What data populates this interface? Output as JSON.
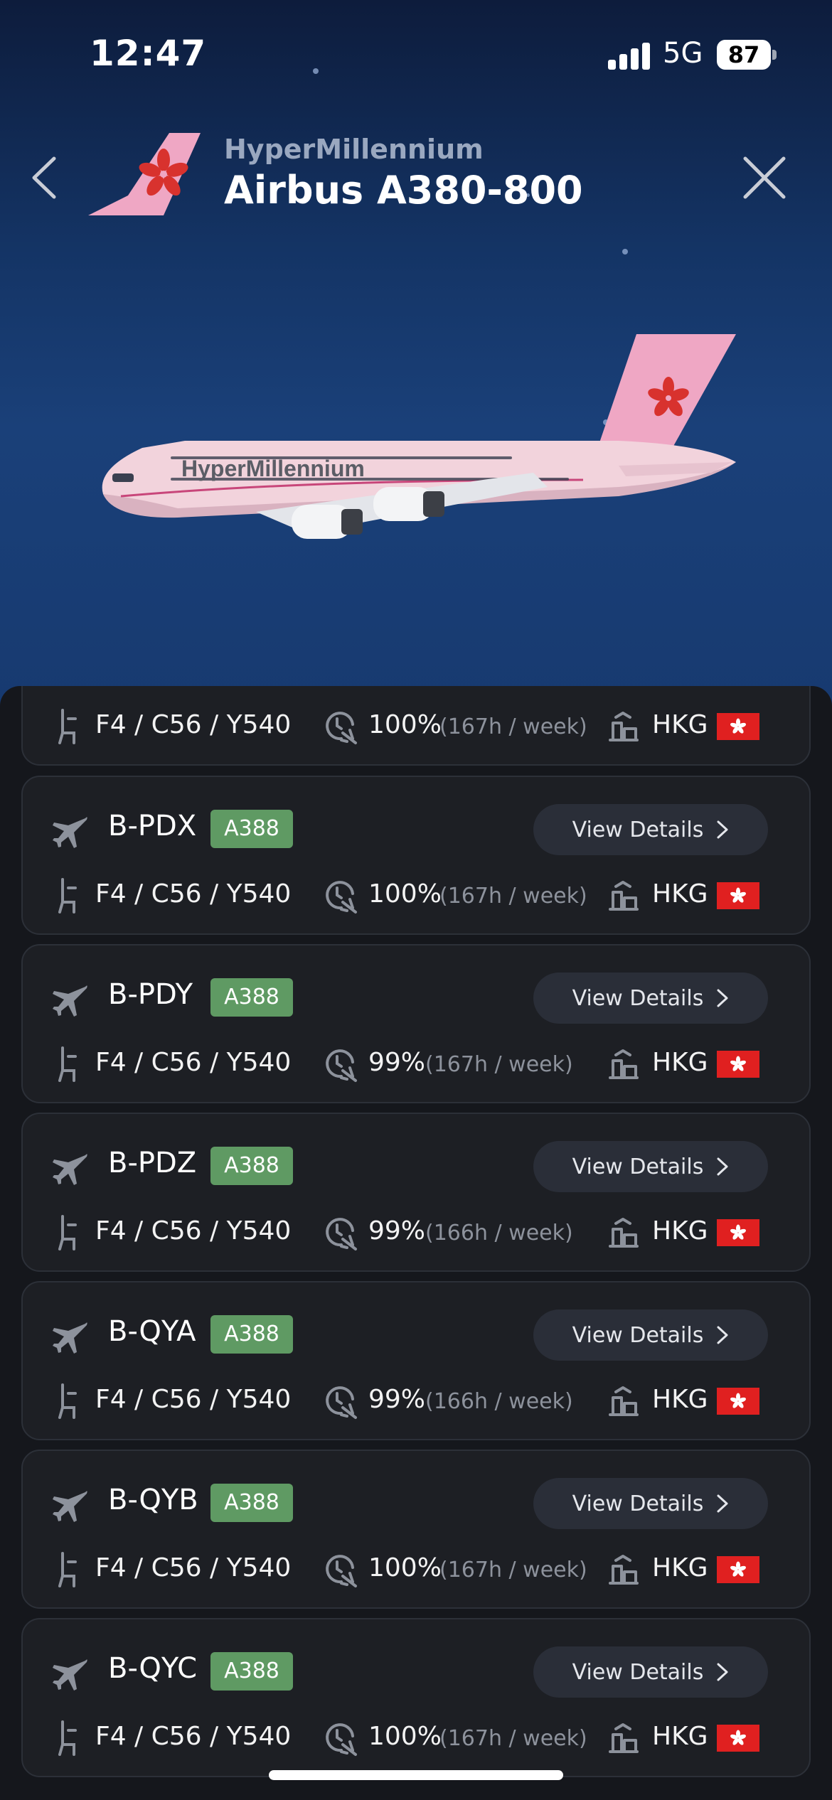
{
  "status_bar": {
    "time": "12:47",
    "network": "5G",
    "battery": "87"
  },
  "header": {
    "airline": "HyperMillennium",
    "model": "Airbus A380-800"
  },
  "colors": {
    "badge": "#5f9a63",
    "flag_red": "#e02020",
    "tail_pink": "#efa7c4"
  },
  "list": {
    "details_label": "View Details",
    "partial_row": {
      "config": "F4 / C56 / Y540",
      "utilization": "100%",
      "hours": "(167h / week)",
      "base": "HKG"
    },
    "aircraft": [
      {
        "reg": "B-PDX",
        "type": "A388",
        "config": "F4 / C56 / Y540",
        "utilization": "100%",
        "hours": "(167h / week)",
        "base": "HKG"
      },
      {
        "reg": "B-PDY",
        "type": "A388",
        "config": "F4 / C56 / Y540",
        "utilization": "99%",
        "hours": "(167h / week)",
        "base": "HKG"
      },
      {
        "reg": "B-PDZ",
        "type": "A388",
        "config": "F4 / C56 / Y540",
        "utilization": "99%",
        "hours": "(166h / week)",
        "base": "HKG"
      },
      {
        "reg": "B-QYA",
        "type": "A388",
        "config": "F4 / C56 / Y540",
        "utilization": "99%",
        "hours": "(166h / week)",
        "base": "HKG"
      },
      {
        "reg": "B-QYB",
        "type": "A388",
        "config": "F4 / C56 / Y540",
        "utilization": "100%",
        "hours": "(167h / week)",
        "base": "HKG"
      },
      {
        "reg": "B-QYC",
        "type": "A388",
        "config": "F4 / C56 / Y540",
        "utilization": "100%",
        "hours": "(167h / week)",
        "base": "HKG"
      }
    ]
  }
}
